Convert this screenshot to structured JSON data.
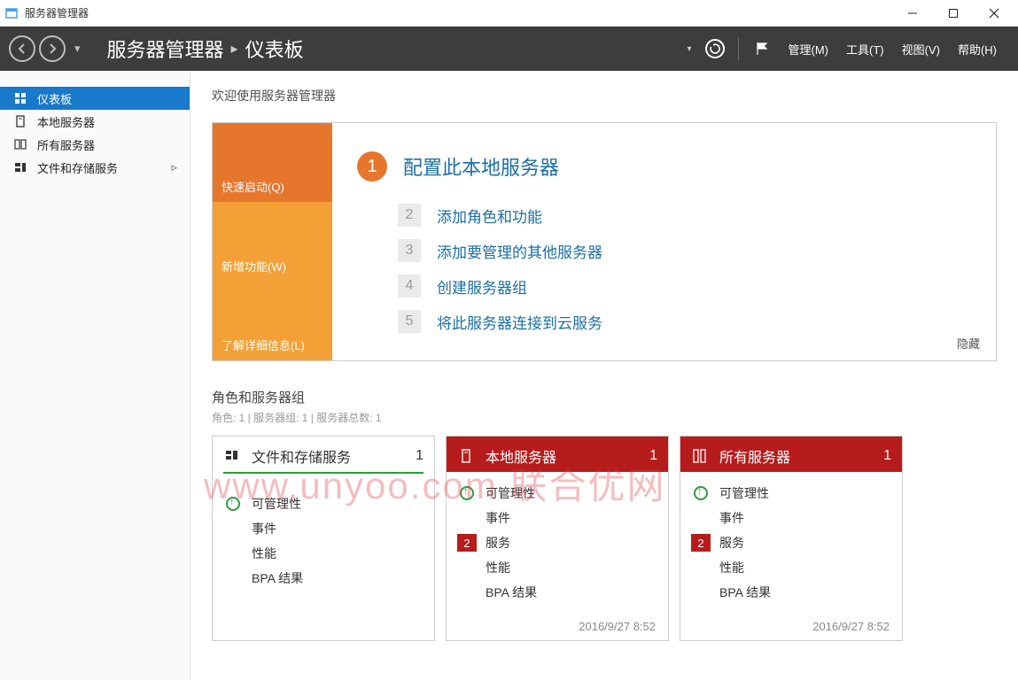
{
  "window": {
    "title": "服务器管理器"
  },
  "header": {
    "crumb1": "服务器管理器",
    "crumb2": "仪表板",
    "menu": {
      "manage": "管理(M)",
      "tools": "工具(T)",
      "view": "视图(V)",
      "help": "帮助(H)"
    }
  },
  "sidebar": {
    "items": [
      {
        "label": "仪表板"
      },
      {
        "label": "本地服务器"
      },
      {
        "label": "所有服务器"
      },
      {
        "label": "文件和存储服务"
      }
    ]
  },
  "welcome": {
    "heading": "欢迎使用服务器管理器",
    "tabs": {
      "quick": "快速启动(Q)",
      "new": "新增功能(W)",
      "learn": "了解详细信息(L)"
    },
    "steps": [
      {
        "num": "1",
        "label": "配置此本地服务器"
      },
      {
        "num": "2",
        "label": "添加角色和功能"
      },
      {
        "num": "3",
        "label": "添加要管理的其他服务器"
      },
      {
        "num": "4",
        "label": "创建服务器组"
      },
      {
        "num": "5",
        "label": "将此服务器连接到云服务"
      }
    ],
    "hide": "隐藏"
  },
  "roles": {
    "heading": "角色和服务器组",
    "sub": "角色: 1 | 服务器组: 1 | 服务器总数: 1",
    "labels": {
      "manage": "可管理性",
      "events": "事件",
      "services": "服务",
      "perf": "性能",
      "bpa": "BPA 结果"
    },
    "tiles": [
      {
        "title": "文件和存储服务",
        "count": "1",
        "type": "green",
        "badge": null,
        "ts": ""
      },
      {
        "title": "本地服务器",
        "count": "1",
        "type": "red",
        "badge": "2",
        "ts": "2016/9/27 8:52"
      },
      {
        "title": "所有服务器",
        "count": "1",
        "type": "red",
        "badge": "2",
        "ts": "2016/9/27 8:52"
      }
    ]
  },
  "watermark": "www.unyoo.com 联合优网"
}
